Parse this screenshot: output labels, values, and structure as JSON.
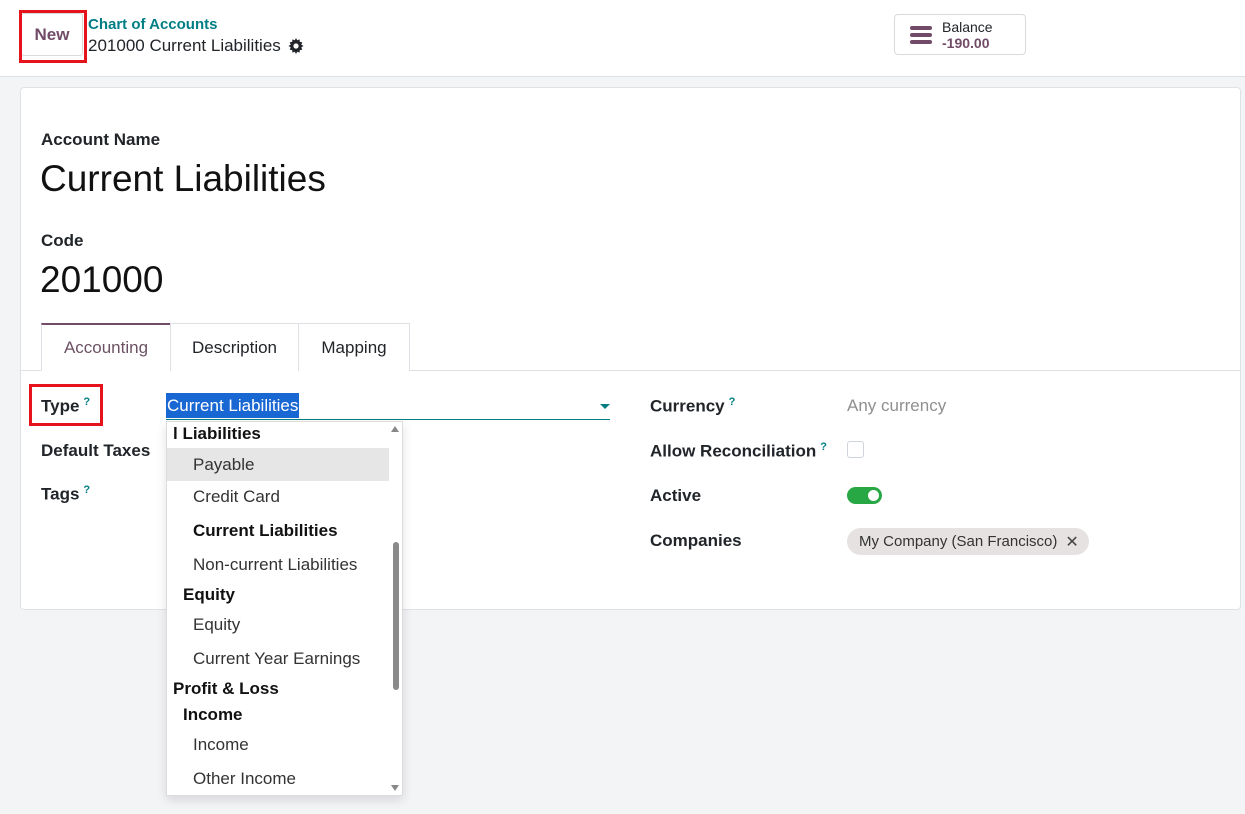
{
  "control_panel": {
    "new_label": "New",
    "breadcrumb_parent": "Chart of Accounts",
    "breadcrumb_current": "201000 Current Liabilities",
    "balance_label": "Balance",
    "balance_value": "-190.00"
  },
  "form": {
    "account_name_label": "Account Name",
    "account_name": "Current Liabilities",
    "code_label": "Code",
    "code": "201000"
  },
  "tabs": [
    {
      "label": "Accounting",
      "active": true
    },
    {
      "label": "Description",
      "active": false
    },
    {
      "label": "Mapping",
      "active": false
    }
  ],
  "fields": {
    "type_label": "Type",
    "type_value": "Current Liabilities",
    "default_taxes_label": "Default Taxes",
    "tags_label": "Tags",
    "currency_label": "Currency",
    "currency_value": "Any currency",
    "allow_reconciliation_label": "Allow Reconciliation",
    "active_label": "Active",
    "companies_label": "Companies",
    "company_tag": "My Company (San Francisco)",
    "help_mark": "?"
  },
  "dropdown": {
    "items": [
      {
        "text": "l Liabilities",
        "kind": "group"
      },
      {
        "text": "Payable",
        "kind": "option-hover"
      },
      {
        "text": "Credit Card",
        "kind": "option"
      },
      {
        "text": "Current Liabilities",
        "kind": "option-current"
      },
      {
        "text": "Non-current Liabilities",
        "kind": "option"
      },
      {
        "text": "Equity",
        "kind": "subgroup"
      },
      {
        "text": "Equity",
        "kind": "option"
      },
      {
        "text": "Current Year Earnings",
        "kind": "option"
      },
      {
        "text": "Profit & Loss",
        "kind": "group"
      },
      {
        "text": "Income",
        "kind": "subgroup"
      },
      {
        "text": "Income",
        "kind": "option"
      },
      {
        "text": "Other Income",
        "kind": "option"
      }
    ]
  },
  "colors": {
    "brand": "#714b67",
    "teal": "#017e84",
    "highlight": "#e5141c",
    "toggle_on": "#28a745"
  }
}
